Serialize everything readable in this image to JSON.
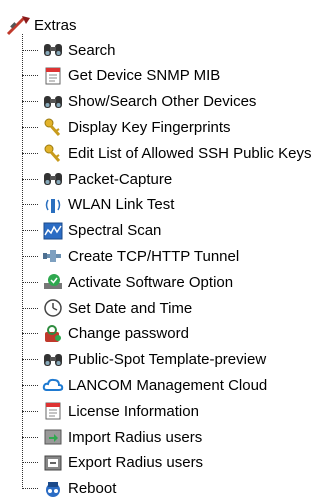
{
  "tree": {
    "root": {
      "label": "Extras",
      "icon": "extras-tools-icon"
    },
    "items": [
      {
        "label": "Search",
        "icon": "binoculars-icon"
      },
      {
        "label": "Get Device SNMP MIB",
        "icon": "document-icon"
      },
      {
        "label": "Show/Search Other Devices",
        "icon": "binoculars-icon"
      },
      {
        "label": "Display Key Fingerprints",
        "icon": "key-icon"
      },
      {
        "label": "Edit List of Allowed SSH Public Keys",
        "icon": "key-icon"
      },
      {
        "label": "Packet-Capture",
        "icon": "binoculars-icon"
      },
      {
        "label": "WLAN Link Test",
        "icon": "wlan-antenna-icon"
      },
      {
        "label": "Spectral Scan",
        "icon": "spectrum-icon"
      },
      {
        "label": "Create TCP/HTTP Tunnel",
        "icon": "tunnel-icon"
      },
      {
        "label": "Activate Software Option",
        "icon": "software-option-icon"
      },
      {
        "label": "Set Date and Time",
        "icon": "clock-icon"
      },
      {
        "label": "Change password",
        "icon": "password-icon"
      },
      {
        "label": "Public-Spot Template-preview",
        "icon": "binoculars-icon"
      },
      {
        "label": "LANCOM Management Cloud",
        "icon": "cloud-icon"
      },
      {
        "label": "License Information",
        "icon": "document-icon"
      },
      {
        "label": "Import Radius users",
        "icon": "import-icon"
      },
      {
        "label": "Export Radius users",
        "icon": "export-icon"
      },
      {
        "label": "Reboot",
        "icon": "reboot-icon"
      }
    ]
  }
}
